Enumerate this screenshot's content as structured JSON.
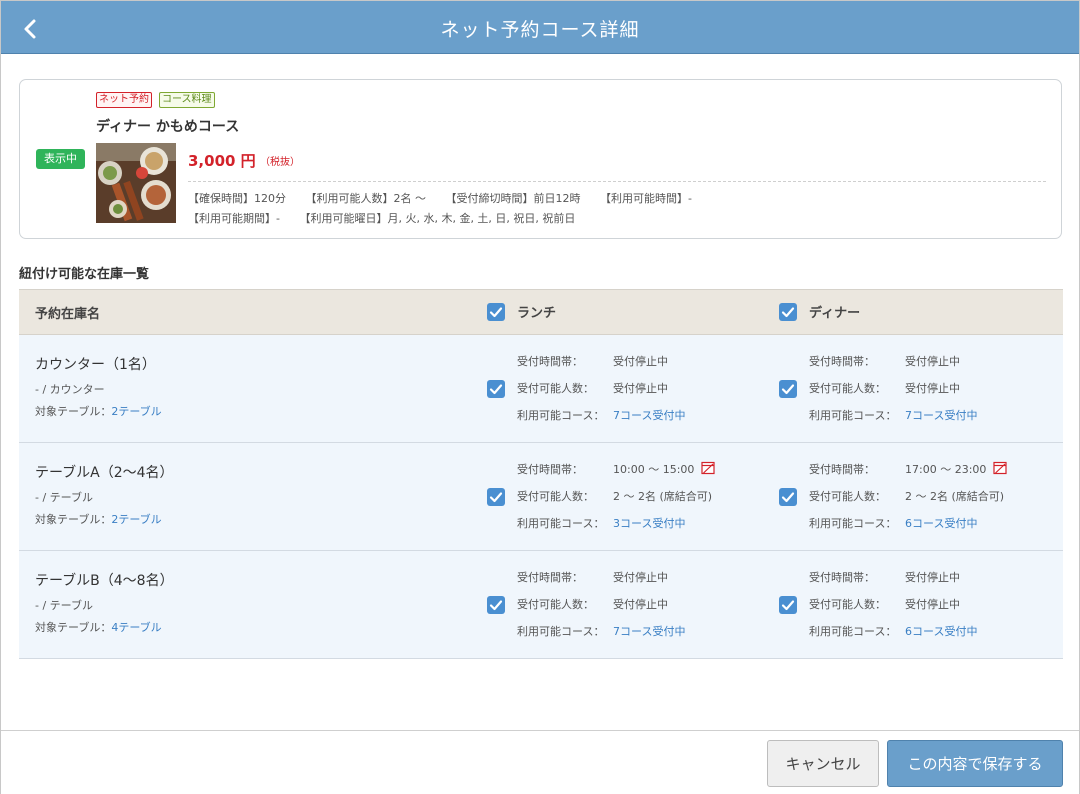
{
  "header": {
    "title": "ネット予約コース詳細"
  },
  "course": {
    "status": "表示中",
    "tags": [
      "ネット予約",
      "コース料理"
    ],
    "name": "ディナー かもめコース",
    "price": "3,000 円",
    "price_note": "（税抜）",
    "meta": {
      "row1": [
        "【確保時間】120分",
        "【利用可能人数】2名 〜",
        "【受付締切時間】前日12時",
        "【利用可能時間】-"
      ],
      "row2": [
        "【利用可能期間】-",
        "【利用可能曜日】月, 火, 水, 木, 金, 土, 日, 祝日, 祝前日"
      ]
    }
  },
  "inventory": {
    "section_title": "紐付け可能な在庫一覧",
    "header": {
      "name": "予約在庫名",
      "lunch": "ランチ",
      "dinner": "ディナー"
    },
    "labels": {
      "time": "受付時間帯：",
      "people": "受付可能人数：",
      "courses": "利用可能コース："
    },
    "rows": [
      {
        "name": "カウンター（1名）",
        "sub": "- / カウンター",
        "tables_label": "対象テーブル：",
        "tables_link": "2テーブル",
        "lunch": {
          "time": "受付停止中",
          "people": "受付停止中",
          "courses": "7コース受付中"
        },
        "dinner": {
          "time": "受付停止中",
          "people": "受付停止中",
          "courses": "7コース受付中"
        }
      },
      {
        "name": "テーブルA（2〜4名）",
        "sub": "- / テーブル",
        "tables_label": "対象テーブル：",
        "tables_link": "2テーブル",
        "lunch": {
          "time": "10:00 〜 15:00",
          "people": "2 〜 2名 (席結合可)",
          "courses": "3コース受付中"
        },
        "dinner": {
          "time": "17:00 〜 23:00",
          "people": "2 〜 2名 (席結合可)",
          "courses": "6コース受付中"
        }
      },
      {
        "name": "テーブルB（4〜8名）",
        "sub": "- / テーブル",
        "tables_label": "対象テーブル：",
        "tables_link": "4テーブル",
        "lunch": {
          "time": "受付停止中",
          "people": "受付停止中",
          "courses": "7コース受付中"
        },
        "dinner": {
          "time": "受付停止中",
          "people": "受付停止中",
          "courses": "6コース受付中"
        }
      }
    ]
  },
  "footer": {
    "cancel": "キャンセル",
    "save": "この内容で保存する"
  },
  "colors": {
    "header": "#6a9fcb",
    "accent": "#4a8fd1",
    "status": "#2fb45a",
    "price": "#d3222a",
    "link": "#3a7fc4"
  }
}
